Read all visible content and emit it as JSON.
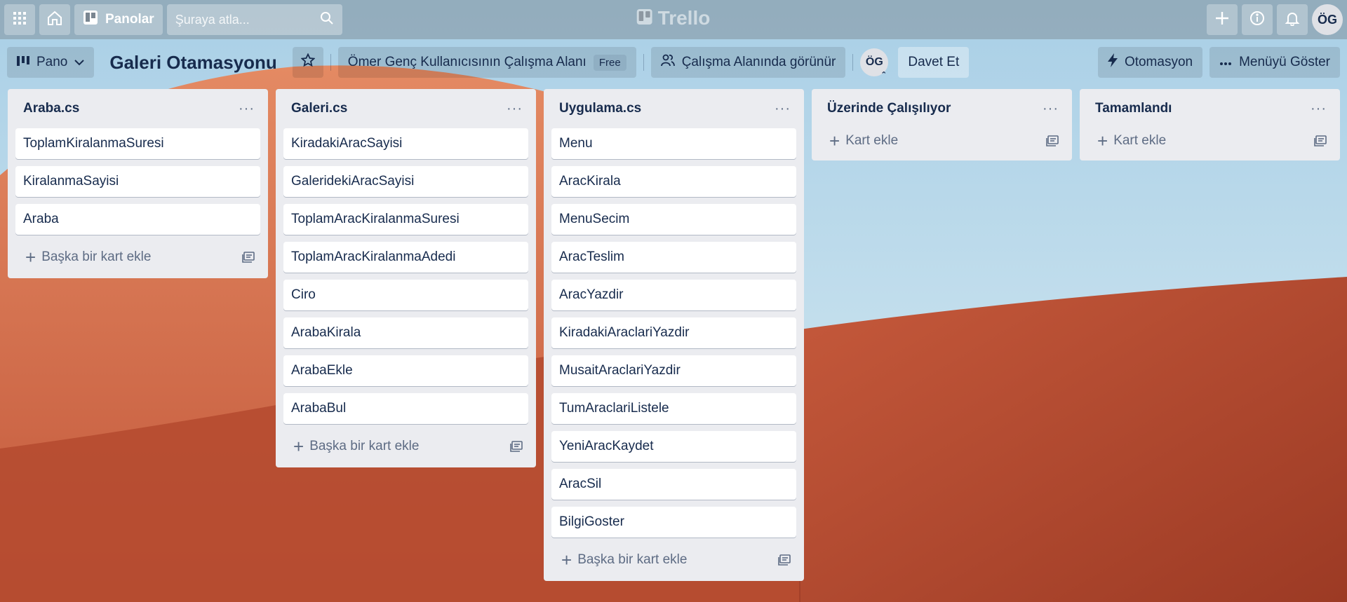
{
  "header": {
    "boards_label": "Panolar",
    "search_placeholder": "Şuraya atla...",
    "logo_text": "Trello",
    "user_initials": "ÖG"
  },
  "board": {
    "view_label": "Pano",
    "title": "Galeri Otamasyonu",
    "workspace_label": "Ömer Genç Kullanıcısının Çalışma Alanı",
    "plan_badge": "Free",
    "visibility_label": "Çalışma Alanında görünür",
    "member_initials": "ÖG",
    "invite_label": "Davet Et",
    "automation_label": "Otomasyon",
    "menu_label": "Menüyü Göster"
  },
  "lists": [
    {
      "title": "Araba.cs",
      "cards": [
        "ToplamKiralanmaSuresi",
        "KiralanmaSayisi",
        "Araba"
      ],
      "add_label": "Başka bir kart ekle"
    },
    {
      "title": "Galeri.cs",
      "cards": [
        "KiradakiAracSayisi",
        "GaleridekiAracSayisi",
        "ToplamAracKiralanmaSuresi",
        "ToplamAracKiralanmaAdedi",
        "Ciro",
        "ArabaKirala",
        "ArabaEkle",
        "ArabaBul"
      ],
      "add_label": "Başka bir kart ekle"
    },
    {
      "title": "Uygulama.cs",
      "cards": [
        "Menu",
        "AracKirala",
        "MenuSecim",
        "AracTeslim",
        "AracYazdir",
        "KiradakiAraclariYazdir",
        "MusaitAraclariYazdir",
        "TumAraclariListele",
        "YeniAracKaydet",
        "AracSil",
        "BilgiGoster"
      ],
      "add_label": "Başka bir kart ekle"
    },
    {
      "title": "Üzerinde Çalışılıyor",
      "cards": [],
      "add_label": "Kart ekle"
    },
    {
      "title": "Tamamlandı",
      "cards": [],
      "add_label": "Kart ekle"
    }
  ],
  "icons": {
    "apps": "apps-grid-icon",
    "home": "home-icon",
    "boards": "boards-icon",
    "search": "search-icon",
    "create": "plus-icon",
    "info": "info-icon",
    "notifications": "bell-icon",
    "star": "star-icon",
    "automation": "lightning-icon",
    "more": "ellipsis-icon",
    "template": "card-template-icon"
  },
  "colors": {
    "list_bg": "#ebecf0",
    "card_bg": "#ffffff",
    "text": "#172b4d",
    "muted": "#5e6c84"
  }
}
